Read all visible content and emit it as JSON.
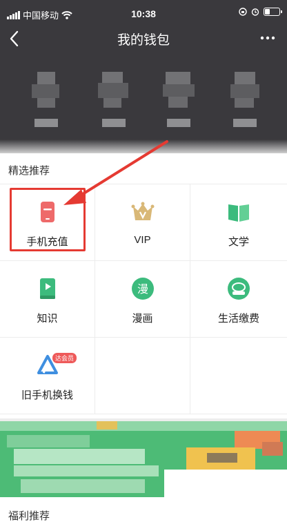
{
  "status": {
    "carrier": "中国移动",
    "time": "10:38"
  },
  "nav": {
    "back_icon": "chevron-left-icon",
    "title": "我的钱包",
    "more_icon": "more-dots-icon"
  },
  "section": {
    "title": "精选推荐",
    "items": [
      {
        "label": "手机充值",
        "icon": "phone-recharge-icon",
        "color": "#ee6a6a"
      },
      {
        "label": "VIP",
        "icon": "crown-icon",
        "color": "#d9b877"
      },
      {
        "label": "文学",
        "icon": "book-open-icon",
        "color": "#3cbb7d"
      },
      {
        "label": "知识",
        "icon": "knowledge-book-icon",
        "color": "#3cbb7d"
      },
      {
        "label": "漫画",
        "icon": "comic-icon",
        "color": "#3cbb7d"
      },
      {
        "label": "生活缴费",
        "icon": "life-payment-icon",
        "color": "#3cbb7d"
      },
      {
        "label": "旧手机换钱",
        "icon": "recycle-phone-icon",
        "color": "#3f8fe0",
        "badge": "达会员"
      }
    ]
  },
  "welfare": {
    "title": "福利推荐"
  },
  "colors": {
    "header_bg": "#3a393d",
    "accent_red": "#e53a32",
    "promo_green": "#4dbb76"
  }
}
